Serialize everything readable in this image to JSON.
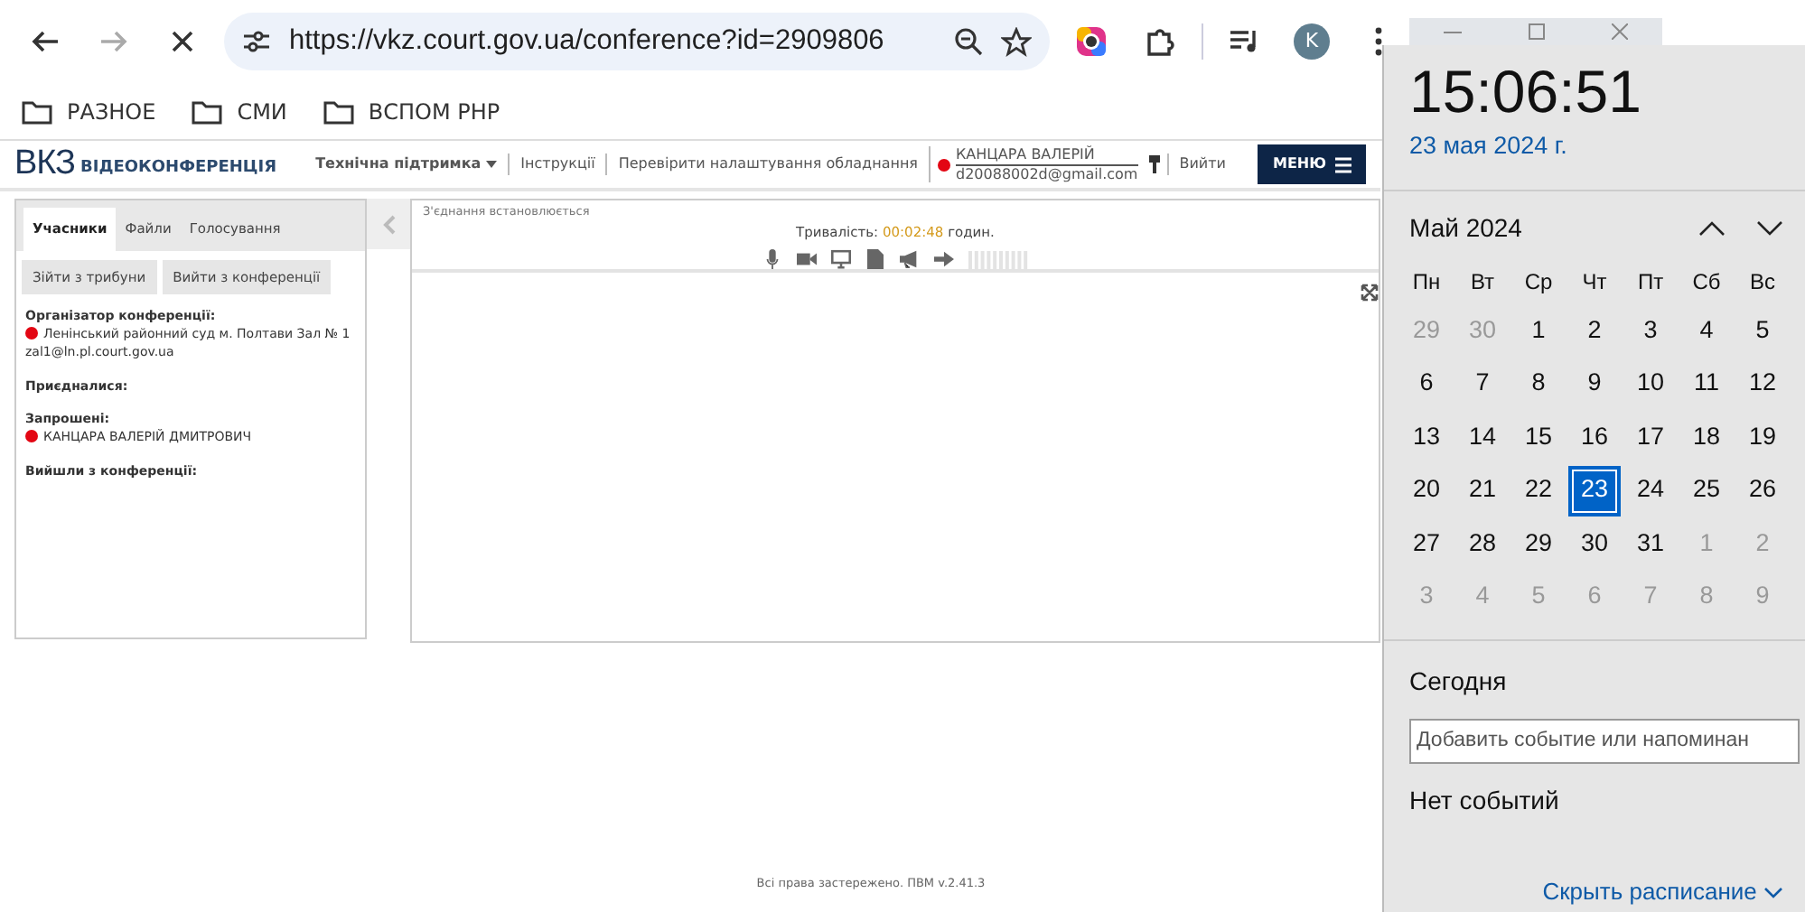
{
  "browser": {
    "url": "https://vkz.court.gov.ua/conference?id=2909806",
    "avatar": "K",
    "bookmarks": [
      "РАЗНОЕ",
      "СМИ",
      "ВСПОМ PHP"
    ]
  },
  "header": {
    "logo": "ВКЗ",
    "logo_subtitle": "ВІДЕОКОНФЕРЕНЦІЯ",
    "links": [
      "Технічна підтримка",
      "Інструкції",
      "Перевірити налаштування обладнання"
    ],
    "user": {
      "name": "КАНЦАРА ВАЛЕРІЙ",
      "email": "d20088002d@gmail.com",
      "color": "#e30613"
    },
    "logout": "Вийти",
    "menu": "МЕНЮ"
  },
  "tabs": [
    {
      "label": "Учасники",
      "selected": true
    },
    {
      "label": "Файли",
      "selected": false
    },
    {
      "label": "Голосування",
      "selected": false
    }
  ],
  "actions": [
    "Зійти з трибуни",
    "Вийти з конференції"
  ],
  "sections": [
    {
      "title": "Організатор конференції:",
      "members": [
        {
          "name": "Ленінський районний суд м. Полтави Зал № 1",
          "email": "zal1@ln.pl.court.gov.ua",
          "color": "#e30613"
        }
      ]
    },
    {
      "title": "Приєдналися:"
    },
    {
      "title": "Запрошені:",
      "members": [
        {
          "name": "КАНЦАРА ВАЛЕРІЙ ДМИТРОВИЧ",
          "color": "#e30613"
        }
      ]
    },
    {
      "title": "Вийшли з конференції:"
    }
  ],
  "conference": {
    "status": "З'єднання встановлюється",
    "duration_label": "Тривалість:",
    "duration": "00:02:48",
    "duration_unit": "годин."
  },
  "footer": "Всі права застережено. ПВМ v.2.41.3",
  "clock": {
    "time": "15:06:51",
    "date": "23 мая 2024 г.",
    "month": "Май 2024",
    "weekdays": [
      "Пн",
      "Вт",
      "Ср",
      "Чт",
      "Пт",
      "Сб",
      "Вс"
    ],
    "weeks": [
      [
        {
          "day": "29",
          "muted": true,
          "selected": false
        },
        {
          "day": "30",
          "muted": true,
          "selected": false
        },
        {
          "day": "1",
          "muted": false,
          "selected": false
        },
        {
          "day": "2",
          "muted": false,
          "selected": false
        },
        {
          "day": "3",
          "muted": false,
          "selected": false
        },
        {
          "day": "4",
          "muted": false,
          "selected": false
        },
        {
          "day": "5",
          "muted": false,
          "selected": false
        }
      ],
      [
        {
          "day": "6",
          "muted": false,
          "selected": false
        },
        {
          "day": "7",
          "muted": false,
          "selected": false
        },
        {
          "day": "8",
          "muted": false,
          "selected": false
        },
        {
          "day": "9",
          "muted": false,
          "selected": false
        },
        {
          "day": "10",
          "muted": false,
          "selected": false
        },
        {
          "day": "11",
          "muted": false,
          "selected": false
        },
        {
          "day": "12",
          "muted": false,
          "selected": false
        }
      ],
      [
        {
          "day": "13",
          "muted": false,
          "selected": false
        },
        {
          "day": "14",
          "muted": false,
          "selected": false
        },
        {
          "day": "15",
          "muted": false,
          "selected": false
        },
        {
          "day": "16",
          "muted": false,
          "selected": false
        },
        {
          "day": "17",
          "muted": false,
          "selected": false
        },
        {
          "day": "18",
          "muted": false,
          "selected": false
        },
        {
          "day": "19",
          "muted": false,
          "selected": false
        }
      ],
      [
        {
          "day": "20",
          "muted": false,
          "selected": false
        },
        {
          "day": "21",
          "muted": false,
          "selected": false
        },
        {
          "day": "22",
          "muted": false,
          "selected": false
        },
        {
          "day": "23",
          "muted": false,
          "selected": true
        },
        {
          "day": "24",
          "muted": false,
          "selected": false
        },
        {
          "day": "25",
          "muted": false,
          "selected": false
        },
        {
          "day": "26",
          "muted": false,
          "selected": false
        }
      ],
      [
        {
          "day": "27",
          "muted": false,
          "selected": false
        },
        {
          "day": "28",
          "muted": false,
          "selected": false
        },
        {
          "day": "29",
          "muted": false,
          "selected": false
        },
        {
          "day": "30",
          "muted": false,
          "selected": false
        },
        {
          "day": "31",
          "muted": false,
          "selected": false
        },
        {
          "day": "1",
          "muted": true,
          "selected": false
        },
        {
          "day": "2",
          "muted": true,
          "selected": false
        }
      ],
      [
        {
          "day": "3",
          "muted": true,
          "selected": false
        },
        {
          "day": "4",
          "muted": true,
          "selected": false
        },
        {
          "day": "5",
          "muted": true,
          "selected": false
        },
        {
          "day": "6",
          "muted": true,
          "selected": false
        },
        {
          "day": "7",
          "muted": true,
          "selected": false
        },
        {
          "day": "8",
          "muted": true,
          "selected": false
        },
        {
          "day": "9",
          "muted": true,
          "selected": false
        }
      ]
    ],
    "today": "Сегодня",
    "placeholder": "Добавить событие или напоминан",
    "no_events": "Нет событий",
    "hide": "Скрыть расписание"
  }
}
